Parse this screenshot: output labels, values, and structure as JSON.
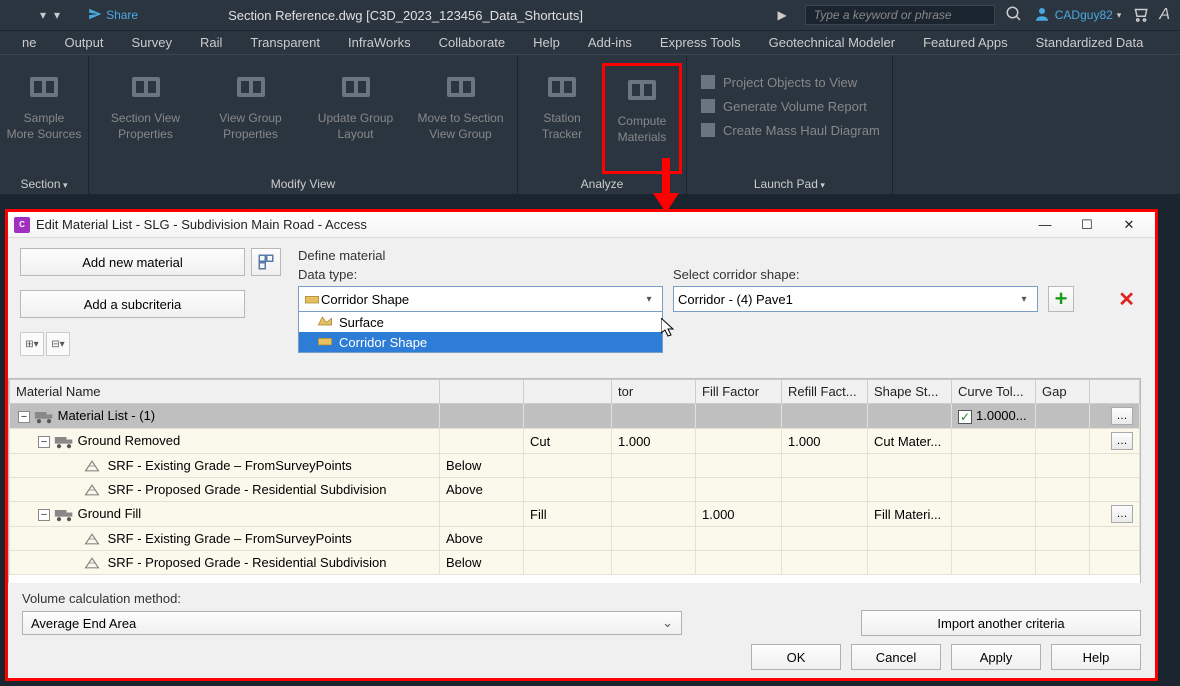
{
  "titlebar": {
    "share": "Share",
    "docTitle": "Section Reference.dwg [C3D_2023_123456_Data_Shortcuts]",
    "searchPlaceholder": "Type a keyword or phrase",
    "username": "CADguy82"
  },
  "menu": [
    "ne",
    "Output",
    "Survey",
    "Rail",
    "Transparent",
    "InfraWorks",
    "Collaborate",
    "Help",
    "Add-ins",
    "Express Tools",
    "Geotechnical Modeler",
    "Featured Apps",
    "Standardized Data"
  ],
  "ribbon": {
    "groups": [
      {
        "label": "Section",
        "drop": true,
        "buttons": [
          {
            "label": "Sample\nMore Sources"
          }
        ]
      },
      {
        "label": "Modify View",
        "drop": false,
        "buttons": [
          {
            "label": "Section View\nProperties"
          },
          {
            "label": "View Group\nProperties"
          },
          {
            "label": "Update Group\nLayout"
          },
          {
            "label": "Move to Section\nView Group"
          }
        ]
      },
      {
        "label": "Analyze",
        "drop": false,
        "buttons": [
          {
            "label": "Station\nTracker"
          },
          {
            "label": "Compute\nMaterials",
            "highlight": true
          }
        ]
      },
      {
        "label": "Launch Pad",
        "drop": true,
        "side": [
          "Project Objects to View",
          "Generate Volume Report",
          "Create Mass Haul Diagram"
        ]
      }
    ]
  },
  "dialog": {
    "title": "Edit Material List - SLG - Subdivision Main Road - Access",
    "addMaterial": "Add new material",
    "addSubcriteria": "Add a subcriteria",
    "defineMaterial": "Define material",
    "dataTypeLabel": "Data type:",
    "dataTypeValue": "Corridor Shape",
    "dataTypeOptions": [
      "Surface",
      "Corridor Shape"
    ],
    "corridorLabel": "Select corridor shape:",
    "corridorValue": "Corridor - (4) Pave1",
    "columns": [
      "Material Name",
      "",
      "",
      "tor",
      "Fill Factor",
      "Refill Fact...",
      "Shape St...",
      "Curve Tol...",
      "Gap",
      ""
    ],
    "rows": [
      {
        "type": "header",
        "name": "Material List - (1)",
        "curveChk": true,
        "curveVal": "1.0000...",
        "ell": true
      },
      {
        "type": "group",
        "name": "Ground Removed",
        "c2": "Cut",
        "c3": "1.000",
        "c5": "1.000",
        "c6": "Cut Mater...",
        "ell": true
      },
      {
        "type": "leaf",
        "name": "SRF - Existing Grade – FromSurveyPoints",
        "c1": "Below"
      },
      {
        "type": "leaf",
        "name": "SRF - Proposed Grade - Residential Subdivision",
        "c1": "Above"
      },
      {
        "type": "group",
        "name": "Ground Fill",
        "c2": "Fill",
        "c4": "1.000",
        "c6": "Fill Materi...",
        "ell": true
      },
      {
        "type": "leaf",
        "name": "SRF - Existing Grade – FromSurveyPoints",
        "c1": "Above"
      },
      {
        "type": "leaf",
        "name": "SRF - Proposed Grade - Residential Subdivision",
        "c1": "Below"
      }
    ],
    "volLabel": "Volume calculation method:",
    "volValue": "Average End Area",
    "importCriteria": "Import another criteria",
    "ok": "OK",
    "cancel": "Cancel",
    "apply": "Apply",
    "help": "Help"
  }
}
